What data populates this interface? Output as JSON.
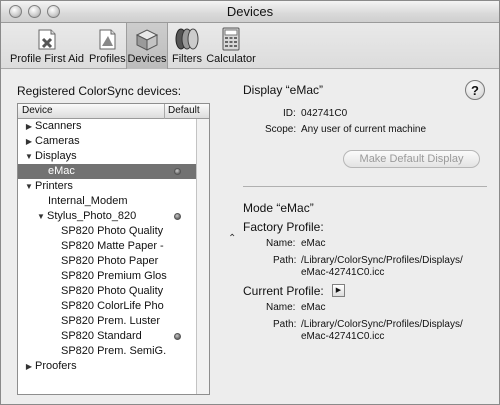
{
  "window": {
    "title": "Devices"
  },
  "toolbar": {
    "items": [
      {
        "label": "Profile First Aid",
        "icon": "first-aid-icon"
      },
      {
        "label": "Profiles",
        "icon": "profiles-icon"
      },
      {
        "label": "Devices",
        "icon": "devices-icon",
        "selected": true
      },
      {
        "label": "Filters",
        "icon": "filters-icon"
      },
      {
        "label": "Calculator",
        "icon": "calculator-icon"
      }
    ]
  },
  "devices": {
    "title": "Registered ColorSync devices:",
    "columns": {
      "device": "Device",
      "default": "Default"
    },
    "rows": [
      {
        "label": "Scanners",
        "expanded": false
      },
      {
        "label": "Cameras",
        "expanded": false
      },
      {
        "label": "Displays",
        "expanded": true
      },
      {
        "label": "eMac"
      },
      {
        "label": "Printers",
        "expanded": true
      },
      {
        "label": "Internal_Modem"
      },
      {
        "label": "Stylus_Photo_820",
        "expanded": true
      },
      {
        "label": "SP820 Photo Quality"
      },
      {
        "label": "SP820 Matte Paper -"
      },
      {
        "label": "SP820 Photo Paper"
      },
      {
        "label": "SP820 Premium Glos"
      },
      {
        "label": "SP820 Photo Quality"
      },
      {
        "label": "SP820 ColorLife Pho"
      },
      {
        "label": "SP820 Prem. Luster"
      },
      {
        "label": "SP820 Standard"
      },
      {
        "label": "SP820 Prem. SemiG."
      },
      {
        "label": "Proofers",
        "expanded": false
      }
    ]
  },
  "display": {
    "title": "Display “eMac”",
    "id_label": "ID:",
    "id_value": "042741C0",
    "scope_label": "Scope:",
    "scope_value": "Any user of current machine",
    "make_default_label": "Make Default Display",
    "help_label": "?"
  },
  "mode": {
    "title": "Mode “eMac”",
    "factory_title": "Factory Profile:",
    "factory_name_label": "Name:",
    "factory_name_value": "eMac",
    "factory_path_label": "Path:",
    "factory_path_line1": "/Library/ColorSync/Profiles/Displays/",
    "factory_path_line2": "eMac-42741C0.icc",
    "current_title": "Current Profile:",
    "current_name_label": "Name:",
    "current_name_value": "eMac",
    "current_path_label": "Path:",
    "current_path_line1": "/Library/ColorSync/Profiles/Displays/",
    "current_path_line2": "eMac-42741C0.icc"
  },
  "colors": {
    "selection": "#727272",
    "window_bg": "#ededed"
  }
}
